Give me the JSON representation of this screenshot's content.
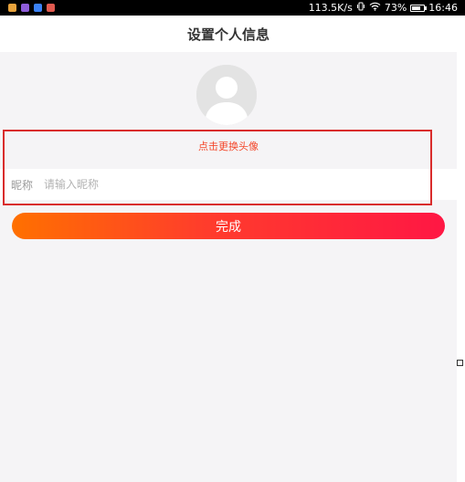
{
  "status_bar": {
    "network_speed": "113.5K/s",
    "battery_level": "73%",
    "battery_fraction": 0.73,
    "time": "16:46",
    "notification_colors": [
      "#e6a23c",
      "#8e5cd9",
      "#3b82f6",
      "#e05a4f"
    ]
  },
  "header": {
    "title": "设置个人信息"
  },
  "profile": {
    "change_avatar_label": "点击更换头像",
    "nickname_label": "昵称",
    "nickname_placeholder": "请输入昵称",
    "nickname_value": ""
  },
  "actions": {
    "done_label": "完成"
  },
  "colors": {
    "accent_red": "#f4472a",
    "gradient_start": "#ff7000",
    "gradient_end": "#ff1744",
    "annotation": "#d92c2c"
  }
}
